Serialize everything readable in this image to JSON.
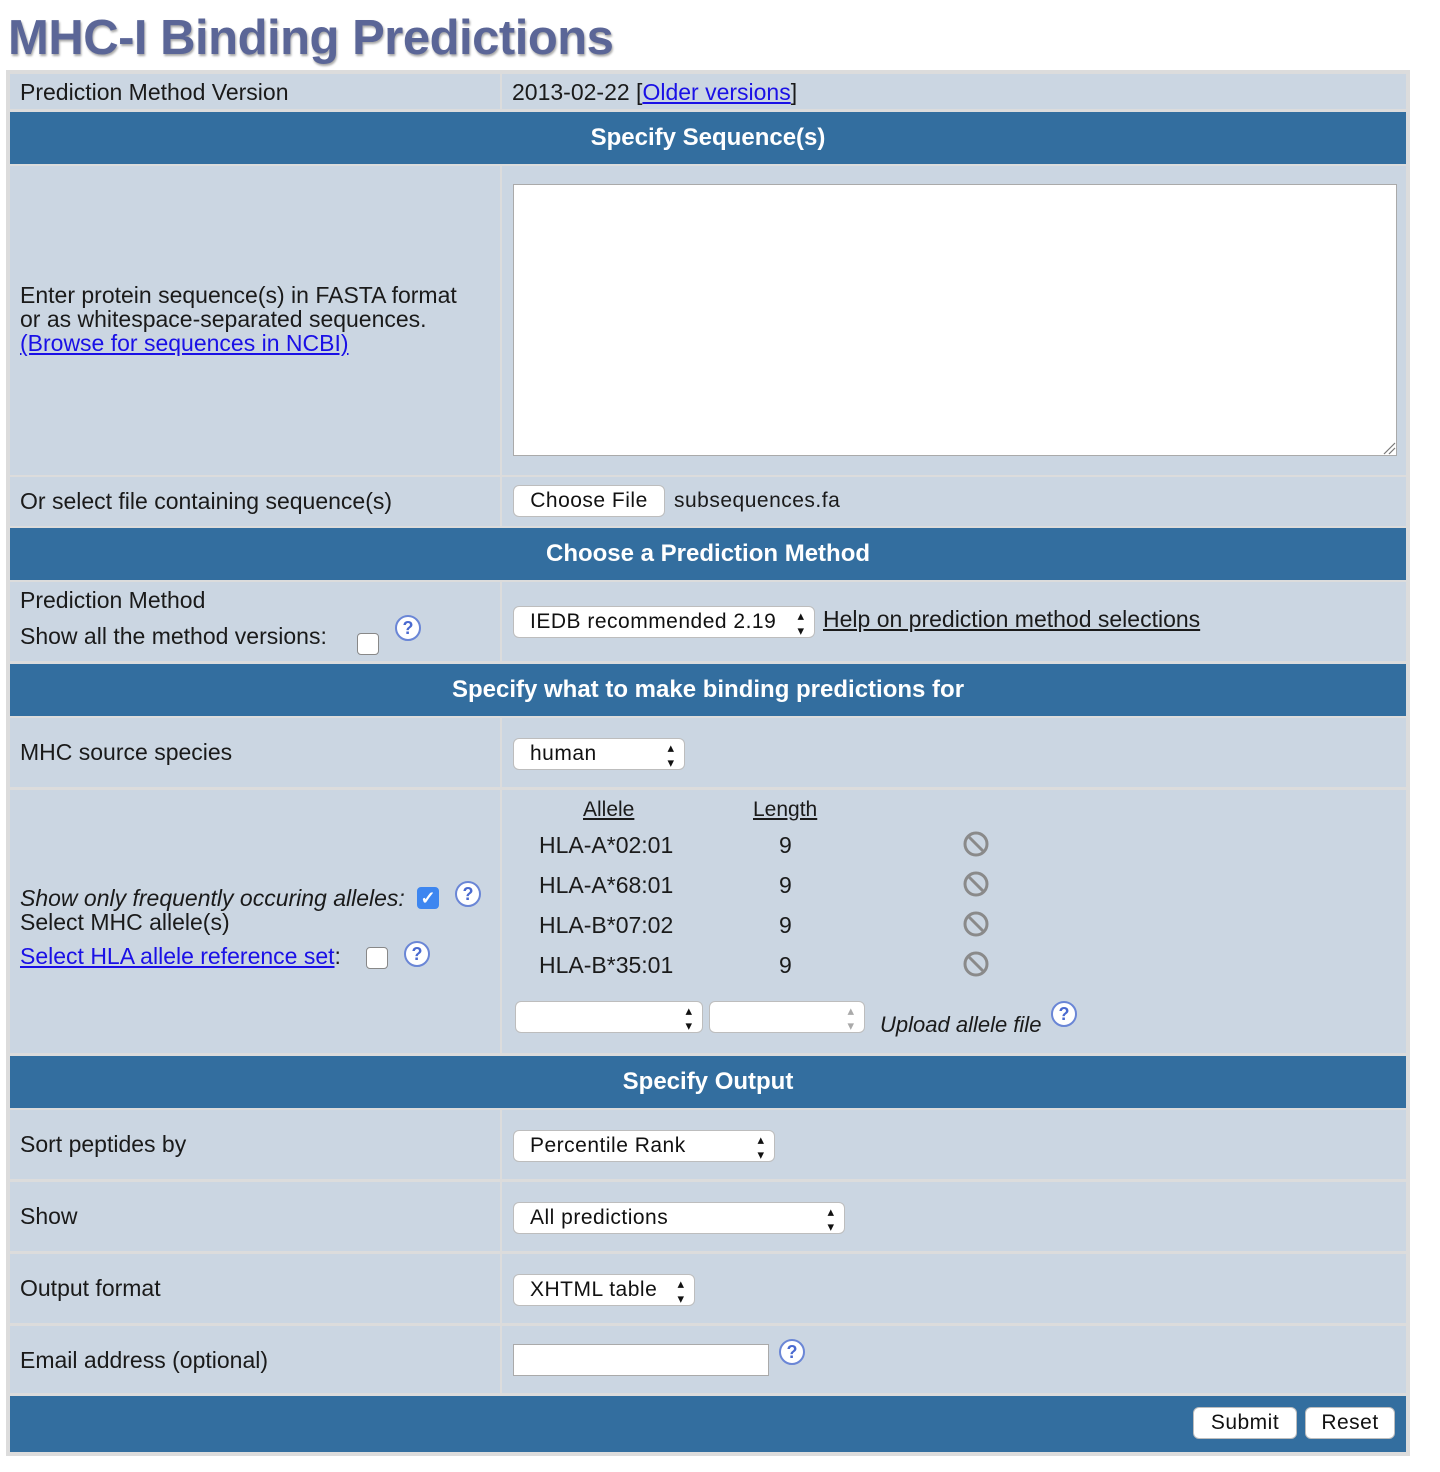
{
  "page_title": "MHC-I Binding Predictions",
  "version_row": {
    "label": "Prediction Method Version",
    "value": "2013-02-22",
    "bracket_open": "[",
    "link": "Older versions",
    "bracket_close": "]"
  },
  "sec_sequences": {
    "header": "Specify Sequence(s)",
    "enter_line1": "Enter protein sequence(s) in FASTA format",
    "enter_line2": "or as whitespace-separated sequences.",
    "browse_link": "(Browse for sequences in NCBI)",
    "textarea_value": "",
    "file_label": "Or select file containing sequence(s)",
    "choose_file": "Choose File",
    "file_name": "subsequences.fa"
  },
  "sec_method": {
    "header": "Choose a Prediction Method",
    "label": "Prediction Method",
    "show_all_label": "Show all the method versions:",
    "show_all_checked": false,
    "method_selected": "IEDB recommended 2.19",
    "help_link": "Help on prediction method selections"
  },
  "sec_binding": {
    "header": "Specify what to make binding predictions for",
    "species_label": "MHC source species",
    "species_selected": "human",
    "freq_label": "Show only frequently occuring alleles:",
    "freq_checked": true,
    "select_label": "Select MHC allele(s)",
    "refset_link": "Select HLA allele reference set",
    "refset_colon": ":",
    "refset_checked": false,
    "col_allele": "Allele",
    "col_length": "Length",
    "alleles": [
      {
        "allele": "HLA-A*02:01",
        "length": "9"
      },
      {
        "allele": "HLA-A*68:01",
        "length": "9"
      },
      {
        "allele": "HLA-B*07:02",
        "length": "9"
      },
      {
        "allele": "HLA-B*35:01",
        "length": "9"
      }
    ],
    "allele_select_value": "",
    "length_select_value": "",
    "upload_link": "Upload allele file"
  },
  "sec_output": {
    "header": "Specify Output",
    "sort_label": "Sort peptides by",
    "sort_selected": "Percentile Rank",
    "show_label": "Show",
    "show_selected": "All predictions",
    "format_label": "Output format",
    "format_selected": "XHTML table",
    "email_label": "Email address (optional)",
    "email_value": ""
  },
  "actions": {
    "submit": "Submit",
    "reset": "Reset"
  },
  "help_glyph": "?",
  "colors": {
    "header_bg": "#336e9f",
    "cell_bg": "#cbd6e2",
    "title": "#5b6697",
    "link": "#1a10e6"
  }
}
